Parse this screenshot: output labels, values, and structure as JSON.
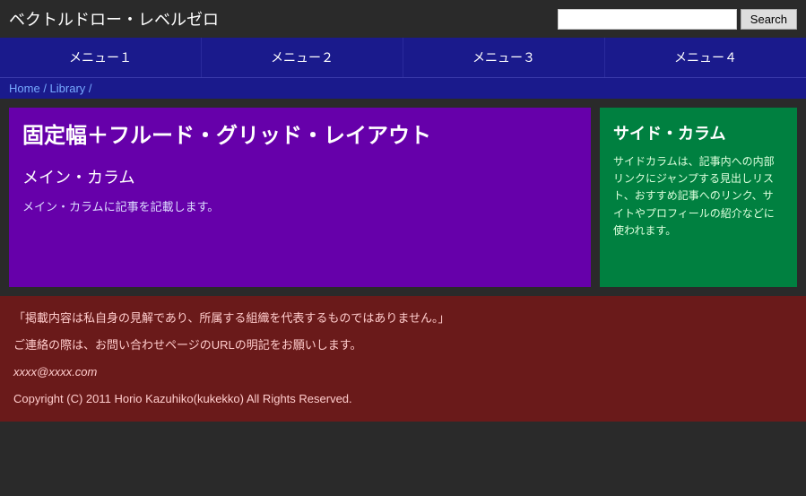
{
  "site": {
    "title": "ベクトルドロー・レベルゼロ"
  },
  "search": {
    "placeholder": "",
    "button_label": "Search"
  },
  "nav": {
    "items": [
      {
        "label": "メニュー１"
      },
      {
        "label": "メニュー２"
      },
      {
        "label": "メニュー３"
      },
      {
        "label": "メニュー４"
      }
    ]
  },
  "breadcrumb": {
    "home": "Home",
    "separator": "/",
    "library": "Library"
  },
  "main": {
    "article_title": "固定幅＋フルード・グリッド・レイアウト",
    "article_subtitle": "メイン・カラム",
    "article_body": "メイン・カラムに記事を記載します。"
  },
  "sidebar": {
    "title": "サイド・カラム",
    "body": "サイドカラムは、記事内への内部リンクにジャンプする見出しリスト、おすすめ記事へのリンク、サイトやプロフィールの紹介などに使われます。"
  },
  "footer": {
    "disclaimer": "「掲載内容は私自身の見解であり、所属する組織を代表するものではありません。」",
    "contact": "ご連絡の際は、お問い合わせページのURLの明記をお願いします。",
    "email": "xxxx@xxxx.com",
    "copyright": "Copyright (C) 2011 Horio Kazuhiko(kukekko) All Rights Reserved."
  }
}
